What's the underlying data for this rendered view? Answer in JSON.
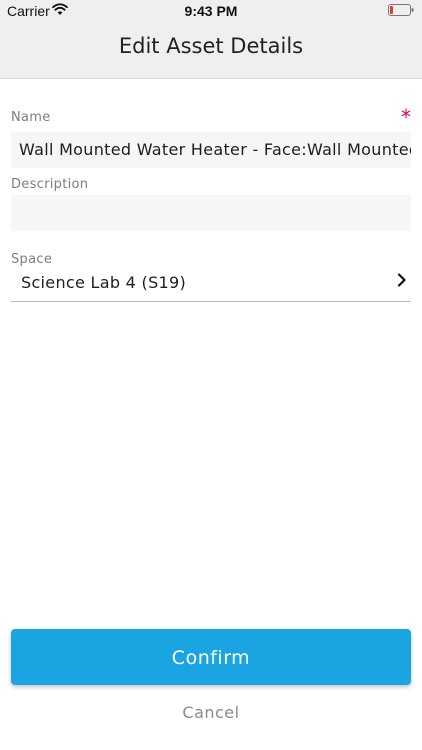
{
  "status_bar": {
    "carrier": "Carrier",
    "time": "9:43 PM",
    "battery_color": "#e53935"
  },
  "header": {
    "title": "Edit Asset Details"
  },
  "form": {
    "name": {
      "label": "Name",
      "required_mark": "*",
      "value": "Wall Mounted Water Heater - Face:Wall Mounted Water Heater"
    },
    "description": {
      "label": "Description",
      "value": ""
    },
    "space": {
      "label": "Space",
      "value": "Science Lab 4 (S19)"
    }
  },
  "actions": {
    "confirm_label": "Confirm",
    "cancel_label": "Cancel",
    "accent_color": "#1ba4e2",
    "required_color": "#d6006e"
  }
}
